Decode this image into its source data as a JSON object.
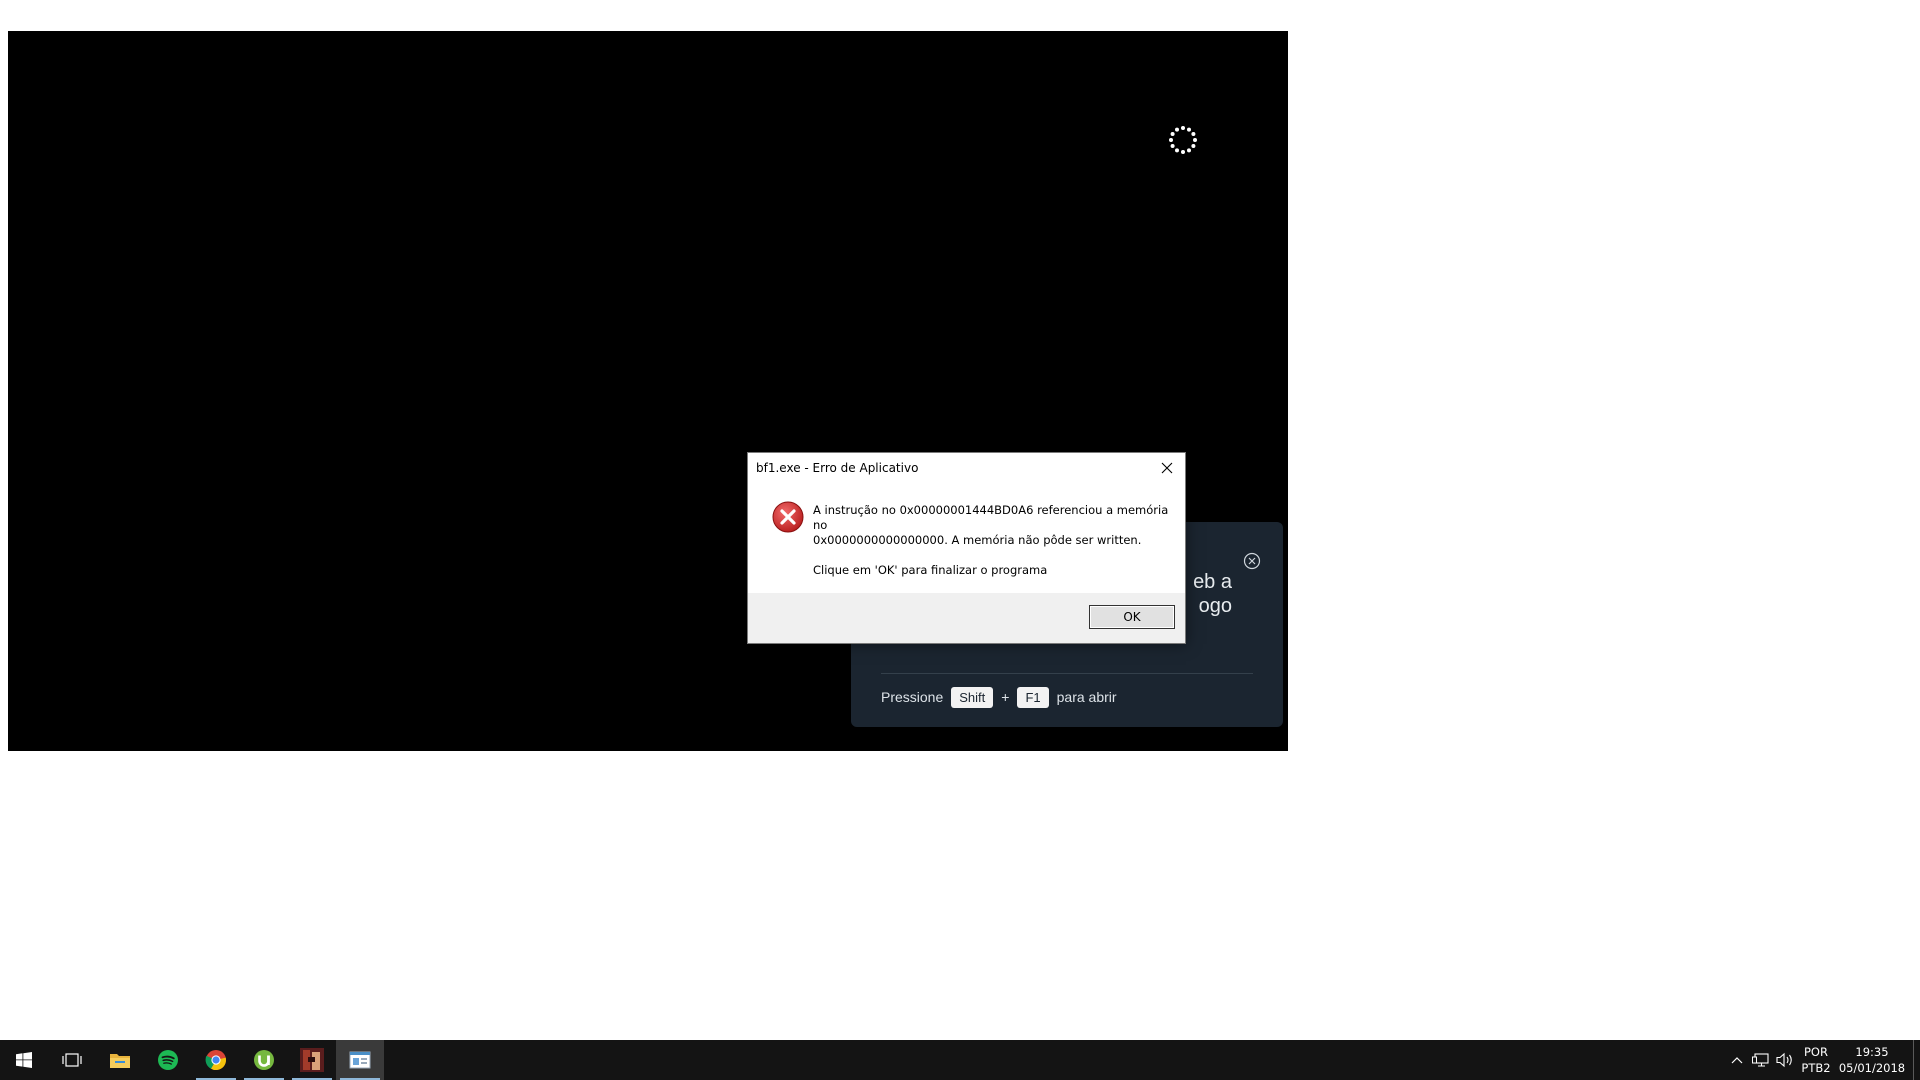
{
  "overlay": {
    "title": "eb a\nogo",
    "hint_prefix": "Pressione",
    "key1": "Shift",
    "plus": "+",
    "key2": "F1",
    "hint_suffix": "para abrir"
  },
  "dialog": {
    "title": "bf1.exe - Erro de Aplicativo",
    "message_line1": "A instrução no 0x00000001444BD0A6 referenciou a memória no",
    "message_line2": "0x0000000000000000. A memória não pôde ser written.",
    "message_line3": "Clique em 'OK' para finalizar o programa",
    "ok_label": "OK"
  },
  "taskbar": {
    "apps": [
      "start-icon",
      "task-view-icon",
      "file-explorer-icon",
      "spotify-icon",
      "chrome-icon",
      "utorrent-icon",
      "game-icon",
      "app-window-icon"
    ],
    "lang_line1": "POR",
    "lang_line2": "PTB2",
    "time": "19:35",
    "date": "05/01/2018"
  },
  "colors": {
    "overlay_bg": "#1b2530",
    "taskbar_bg": "#141414",
    "error_red": "#d32f2f"
  }
}
